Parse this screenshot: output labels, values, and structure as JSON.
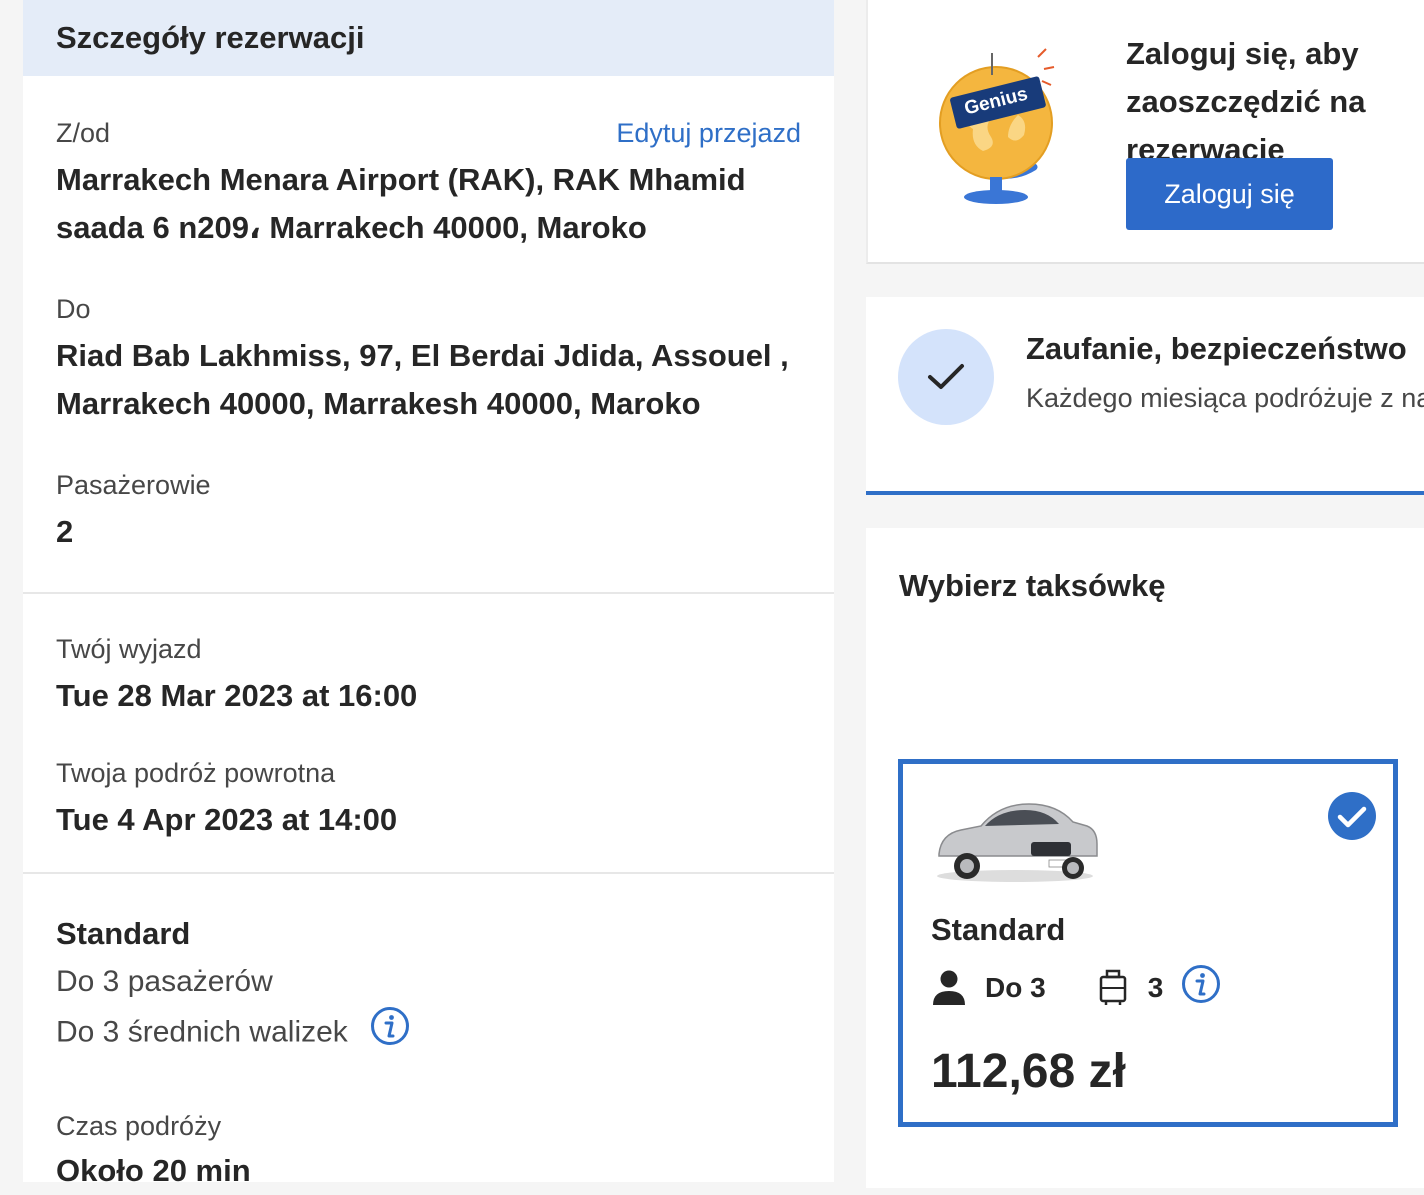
{
  "details": {
    "header": "Szczegóły rezerwacji",
    "from_label": "Z/od",
    "edit_link": "Edytuj przejazd",
    "from_value": "Marrakech Menara Airport (RAK), RAK Mhamid saada 6 n209، Marrakech 40000, Maroko",
    "to_label": "Do",
    "to_value": "Riad Bab Lakhmiss, 97, El Berdai Jdida, Assouel , Marrakech 40000, Marrakesh 40000, Maroko",
    "passengers_label": "Pasażerowie",
    "passengers_value": "2",
    "departure_label": "Twój wyjazd",
    "departure_value": "Tue 28 Mar 2023 at 16:00",
    "return_label": "Twoja podróż powrotna",
    "return_value": "Tue 4 Apr 2023 at 14:00",
    "vehicle_name": "Standard",
    "vehicle_passengers": "Do 3 pasażerów",
    "vehicle_luggage": "Do 3 średnich walizek",
    "travel_time_label": "Czas podróży",
    "travel_time_value": "Około 20 min"
  },
  "login": {
    "badge": "Genius",
    "title": "Zaloguj się, aby zaoszczędzić na rezerwację",
    "button": "Zaloguj się"
  },
  "trust": {
    "title": "Zaufanie, bezpieczeństwo",
    "subtitle": "Każdego miesiąca podróżuje z nami"
  },
  "taxi": {
    "title": "Wybierz taksówkę",
    "option": {
      "name": "Standard",
      "passengers": "Do 3",
      "luggage": "3",
      "price": "112,68 zł",
      "selected": true
    }
  },
  "colors": {
    "accent": "#2f6fc7",
    "header_bg": "#e4ecf8",
    "check_bg": "#d4e3fb"
  }
}
